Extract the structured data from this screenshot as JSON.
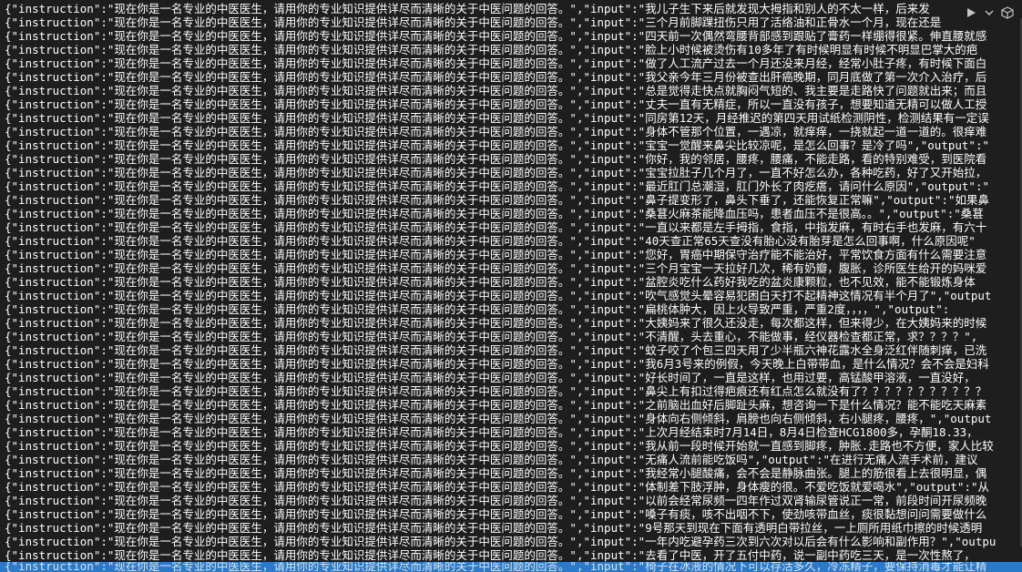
{
  "lines": [
    "{\"instruction\":\"现在你是一名专业的中医医生，请用你的专业知识提供详尽而清晰的关于中医问题的回答。\",\"input\":\"我儿子生下来后就发现大拇指和别人的不太一样，后来发",
    "{\"instruction\":\"现在你是一名专业的中医医生，请用你的专业知识提供详尽而清晰的关于中医问题的回答。\",\"input\":\"三个月前脚踝扭伤只用了活络油和正骨水一个月，现在还是",
    "{\"instruction\":\"现在你是一名专业的中医医生，请用你的专业知识提供详尽而清晰的关于中医问题的回答。\",\"input\":\"四天前一次偶然弯腰背部感到跟贴了膏药一样绷得很紧。伸直腰就感",
    "{\"instruction\":\"现在你是一名专业的中医医生，请用你的专业知识提供详尽而清晰的关于中医问题的回答。\",\"input\":\"脸上小时候被烫伤有10多年了有时候明显有时候不明显巴掌大的疤",
    "{\"instruction\":\"现在你是一名专业的中医医生，请用你的专业知识提供详尽而清晰的关于中医问题的回答。\",\"input\":\"做了人工流产过去一个月还没来月经，经常小肚子疼，有时候下面白",
    "{\"instruction\":\"现在你是一名专业的中医医生，请用你的专业知识提供详尽而清晰的关于中医问题的回答。\",\"input\":\"我父亲今年三月份被查出肝癌晚期，同月底做了第一次介入治疗，后",
    "{\"instruction\":\"现在你是一名专业的中医医生，请用你的专业知识提供详尽而清晰的关于中医问题的回答。\",\"input\":\"总是觉得走快点就胸闷气短的、我主要是走路快了问题就出来；而且",
    "{\"instruction\":\"现在你是一名专业的中医医生，请用你的专业知识提供详尽而清晰的关于中医问题的回答。\",\"input\":\"丈夫一直有无精症，所以一直没有孩子，想要知道无精可以做人工授",
    "{\"instruction\":\"现在你是一名专业的中医医生，请用你的专业知识提供详尽而清晰的关于中医问题的回答。\",\"input\":\"同房第12天，月经推迟的第四天用试纸检测阴性，检测结果有一定误",
    "{\"instruction\":\"现在你是一名专业的中医医生，请用你的专业知识提供详尽而清晰的关于中医问题的回答。\",\"input\":\"身体不管那个位置，一遇凉，就痒痒，一挠就起一道一道的。很痒难",
    "{\"instruction\":\"现在你是一名专业的中医医生，请用你的专业知识提供详尽而清晰的关于中医问题的回答。\",\"input\":\"宝宝一觉醒来鼻尖比较凉呢，是怎么回事？是冷了吗\",\"output\":\"",
    "{\"instruction\":\"现在你是一名专业的中医医生，请用你的专业知识提供详尽而清晰的关于中医问题的回答。\",\"input\":\"你好，我的邻居，腰疼，腰痛，不能走路，看的特别难受，到医院看",
    "{\"instruction\":\"现在你是一名专业的中医医生，请用你的专业知识提供详尽而清晰的关于中医问题的回答。\",\"input\":\"宝宝拉肚子几个月了，一直不好怎么办，各种吃药，好了又开始拉，",
    "{\"instruction\":\"现在你是一名专业的中医医生，请用你的专业知识提供详尽而清晰的关于中医问题的回答。\",\"input\":\"最近肛门总潮湿，肛门外长了肉疙瘩，请问什么原因\",\"output\":\"",
    "{\"instruction\":\"现在你是一名专业的中医医生，请用你的专业知识提供详尽而清晰的关于中医问题的回答。\",\"input\":\"鼻子提变形了，鼻头下垂了，还能恢复正常嘛\",\"output\":\"如果鼻",
    "{\"instruction\":\"现在你是一名专业的中医医生，请用你的专业知识提供详尽而清晰的关于中医问题的回答。\",\"input\":\"桑葚火麻茶能降血压吗，患者血压不是很高。。\",\"output\":\"桑葚",
    "{\"instruction\":\"现在你是一名专业的中医医生，请用你的专业知识提供详尽而清晰的关于中医问题的回答。\",\"input\":\"一直以来都是左手拇指，食指，中指发麻，有时右手也发麻，有六十",
    "{\"instruction\":\"现在你是一名专业的中医医生，请用你的专业知识提供详尽而清晰的关于中医问题的回答。\",\"input\":\"40天查正常65天查没有胎心没有胎芽是怎么回事啊，什么原因呢\"",
    "{\"instruction\":\"现在你是一名专业的中医医生，请用你的专业知识提供详尽而清晰的关于中医问题的回答。\",\"input\":\"您好，胃癌中期保守治疗能不能治好，平常饮食方面有什么需要注意",
    "{\"instruction\":\"现在你是一名专业的中医医生，请用你的专业知识提供详尽而清晰的关于中医问题的回答。\",\"input\":\"三个月宝宝一天拉好几次，稀有奶瓣，腹胀，诊所医生给开的妈咪爱",
    "{\"instruction\":\"现在你是一名专业的中医医生，请用你的专业知识提供详尽而清晰的关于中医问题的回答。\",\"input\":\"盆腔炎吃什么药好我吃的盆炎康颗粒，也不见效，能不能锻炼身体",
    "{\"instruction\":\"现在你是一名专业的中医医生，请用你的专业知识提供详尽而清晰的关于中医问题的回答。\",\"input\":\"吹气感觉头晕容易犯困白天打不起精神这情况有半个月了\",\"output",
    "{\"instruction\":\"现在你是一名专业的中医医生，请用你的专业知识提供详尽而清晰的关于中医问题的回答。\",\"input\":\"扁桃体肿大，因上火导致严重，严重2度，，，，\",\"output\":",
    "{\"instruction\":\"现在你是一名专业的中医医生，请用你的专业知识提供详尽而清晰的关于中医问题的回答。\",\"input\":\"大姨妈来了很久还没走，每次都这样，但来得少，在大姨妈来的时候",
    "{\"instruction\":\"现在你是一名专业的中医医生，请用你的专业知识提供详尽而清晰的关于中医问题的回答。\",\"input\":\"不清醒，头去重心，不能做事，经仪器检查都正常，求？？？？\",",
    "{\"instruction\":\"现在你是一名专业的中医医生，请用你的专业知识提供详尽而清晰的关于中医问题的回答。\",\"input\":\"蚊子咬了个包三四天用了少半瓶六神花露水全身泛红伴随刺痒，已洗",
    "{\"instruction\":\"现在你是一名专业的中医医生，请用你的专业知识提供详尽而清晰的关于中医问题的回答。\",\"input\":\"我6月3号来的例假，今天晚上白带带血，是什么情况？会不会是妇科",
    "{\"instruction\":\"现在你是一名专业的中医医生，请用你的专业知识提供详尽而清晰的关于中医问题的回答。\",\"input\":\"好长时间了，一直是这样，也用过要，高锰酸甲溶液，一直没好，",
    "{\"instruction\":\"现在你是一名专业的中医医生，请用你的专业知识提供详尽而清晰的关于中医问题的回答。\",\"input\":\"鼻尖上有扣过得疤痕还有红点怎么就没有了？？？？？？？？？？？",
    "{\"instruction\":\"现在你是一名专业的中医医生，请用你的专业知识提供详尽而清晰的关于中医问题的回答。\",\"input\":\"之前脑出血好后脚趾头麻，想咨询一下是什么情况？能不能吃天麻素",
    "{\"instruction\":\"现在你是一名专业的中医医生，请用你的专业知识提供详尽而清晰的关于中医问题的回答。\",\"input\":\"身体向右侧倾斜，肩膀也向右侧倾斜，右小腿疼，腰疼，\",\"output",
    "{\"instruction\":\"现在你是一名专业的中医医生，请用你的专业知识提供详尽而清晰的关于中医问题的回答。\",\"input\":\"上次月经结束时7月14日，8月4日检查HCG1800多，孕酮18.33，",
    "{\"instruction\":\"现在你是一名专业的中医医生，请用你的专业知识提供详尽而清晰的关于中医问题的回答。\",\"input\":\"我从前一段时候开始就一直感到脚疼，肿胀.走路也不方便，家人比较",
    "{\"instruction\":\"现在你是一名专业的中医医生，请用你的专业知识提供详尽而清晰的关于中医问题的回答。\",\"input\":\"无痛人流前能吃饭吗\",\"output\":\"在进行无痛人流手术前，建议",
    "{\"instruction\":\"现在你是一名专业的中医医生，请用你的专业知识提供详尽而清晰的关于中医问题的回答。\",\"input\":\"我经常小腿酸痛，会不会是静脉曲张。腿上的筋很看上去很明显，偶",
    "{\"instruction\":\"现在你是一名专业的中医医生，请用你的专业知识提供详尽而清晰的关于中医问题的回答。\",\"input\":\"体制差下肢浮肿，身体瘦的很。不爱吃饭就爱喝水\",\"output\":\"从",
    "{\"instruction\":\"现在你是一名专业的中医医生，请用你的专业知识提供详尽而清晰的关于中医问题的回答。\",\"input\":\"以前会经常尿频一四年作过双肾输尿管说正一常，前段时间开尿频晚",
    "{\"instruction\":\"现在你是一名专业的中医医生，请用你的专业知识提供详尽而清晰的关于中医问题的回答。\",\"input\":\"嗓子有痰，咳不出咽不下，使劲咳带血丝，痰很黏想问问需要做什么",
    "{\"instruction\":\"现在你是一名专业的中医医生，请用你的专业知识提供详尽而清晰的关于中医问题的回答。\",\"input\":\"9号那天到现在下面有透明白带拉丝，一上厕所用纸巾擦的时候透明",
    "{\"instruction\":\"现在你是一名专业的中医医生，请用你的专业知识提供详尽而清晰的关于中医问题的回答。\",\"input\":\"一年内吃避孕药三次到六次对以后会有什么影响和副作用？\",\"outpu",
    "{\"instruction\":\"现在你是一名专业的中医医生，请用你的专业知识提供详尽而清晰的关于中医问题的回答。\",\"input\":\"去看了中医，开了五付中药，说一副中药吃三天，是一次性熬了，"
  ],
  "last_line": "{\"instruction\":\"现在你是一名专业的中医医生，请用你的专业知识提供详尽而清晰的关于中医问题的回答。\",\"input\":\"椅子在冰液的情况下可以存活多久，冷冻精子，要保持消毒才能让精",
  "toolbar": {
    "run_icon": "play-icon",
    "dropdown_icon": "chevron-down-icon",
    "extensions_icon": "cube-icon"
  },
  "colors": {
    "background": "#1e1e1e",
    "text": "#ffffff",
    "selection": "#2b79c9"
  }
}
